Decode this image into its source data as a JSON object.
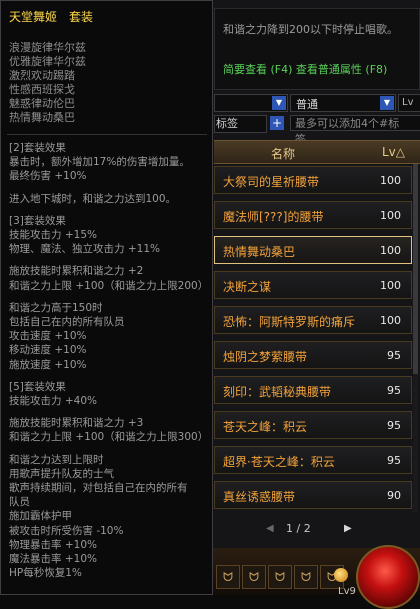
{
  "tooltip": {
    "title": "天堂舞姬　套装",
    "set_items": [
      "浪漫旋律华尔兹",
      "优雅旋律华尔兹",
      "激烈欢动踢踏",
      "性感西班探戈",
      "魅惑律动伦巴",
      "热情舞动桑巴"
    ],
    "effects": [
      {
        "type": "head",
        "text": "[2]套装效果"
      },
      {
        "type": "line",
        "text": "暴击时，额外增加17%的伤害增加量。"
      },
      {
        "type": "line",
        "text": "最终伤害 +10%"
      },
      {
        "type": "gap"
      },
      {
        "type": "line",
        "text": "进入地下城时，和谐之力达到100。"
      },
      {
        "type": "gap"
      },
      {
        "type": "head",
        "text": "[3]套装效果"
      },
      {
        "type": "line",
        "text": "技能攻击力 +15%"
      },
      {
        "type": "line",
        "text": "物理、魔法、独立攻击力 +11%"
      },
      {
        "type": "gap"
      },
      {
        "type": "line",
        "text": "施放技能时累积和谐之力 +2"
      },
      {
        "type": "line",
        "text": "和谐之力上限 +100（和谐之力上限200）"
      },
      {
        "type": "gap"
      },
      {
        "type": "line",
        "text": "和谐之力高于150时"
      },
      {
        "type": "line",
        "text": "包括自己在内的所有队员"
      },
      {
        "type": "line",
        "text": "攻击速度 +10%"
      },
      {
        "type": "line",
        "text": "移动速度 +10%"
      },
      {
        "type": "line",
        "text": "施放速度 +10%"
      },
      {
        "type": "gap"
      },
      {
        "type": "head",
        "text": "[5]套装效果"
      },
      {
        "type": "line",
        "text": "技能攻击力 +40%"
      },
      {
        "type": "gap"
      },
      {
        "type": "line",
        "text": "施放技能时累积和谐之力 +3"
      },
      {
        "type": "line",
        "text": "和谐之力上限 +100（和谐之力上限300）"
      },
      {
        "type": "gap"
      },
      {
        "type": "line",
        "text": "和谐之力达到上限时"
      },
      {
        "type": "line",
        "text": "用歌声提升队友的士气"
      },
      {
        "type": "line",
        "text": "歌声持续期间，对包括自己在内的所有"
      },
      {
        "type": "line",
        "text": "队员"
      },
      {
        "type": "line",
        "text": "施加霸体护甲"
      },
      {
        "type": "line",
        "text": "被攻击时所受伤害 -10%"
      },
      {
        "type": "line",
        "text": "物理暴击率 +10%"
      },
      {
        "type": "line",
        "text": "魔法暴击率 +10%"
      },
      {
        "type": "line",
        "text": "HP每秒恢复1%"
      }
    ]
  },
  "panel": {
    "desc_text": "和谐之力降到200以下时停止唱歌。",
    "desc_links": "简要查看 (F4) 查看普通属性 (F8)",
    "filter_grade": "普通",
    "filter_lv": "Lv",
    "tag_label": "标签",
    "tag_add": "+",
    "tag_placeholder": "最多可以添加4个#标签。",
    "col_name": "名称",
    "col_lv": "Lv△",
    "items": [
      {
        "name": "大祭司的星祈腰带",
        "lv": "100"
      },
      {
        "name": "魔法师[???]的腰带",
        "lv": "100"
      },
      {
        "name": "热情舞动桑巴",
        "lv": "100",
        "selected": true
      },
      {
        "name": "决断之谋",
        "lv": "100"
      },
      {
        "name": "恐怖：阿斯特罗斯的痛斥",
        "lv": "100"
      },
      {
        "name": "烛阴之梦萦腰带",
        "lv": "95"
      },
      {
        "name": "刻印：武韬秘典腰带",
        "lv": "95"
      },
      {
        "name": "苍天之峰：积云",
        "lv": "95"
      },
      {
        "name": "超界·苍天之峰：积云",
        "lv": "95"
      },
      {
        "name": "真丝诱惑腰带",
        "lv": "90"
      }
    ],
    "page_prev": "◀",
    "page_text": "1 / 2",
    "page_next": "▶"
  },
  "bottom": {
    "slot_glyphs": [
      "ᗢ",
      "ᗢ",
      "ᗢ",
      "ᗢ",
      "ᗢ"
    ],
    "level": "Lv9"
  }
}
